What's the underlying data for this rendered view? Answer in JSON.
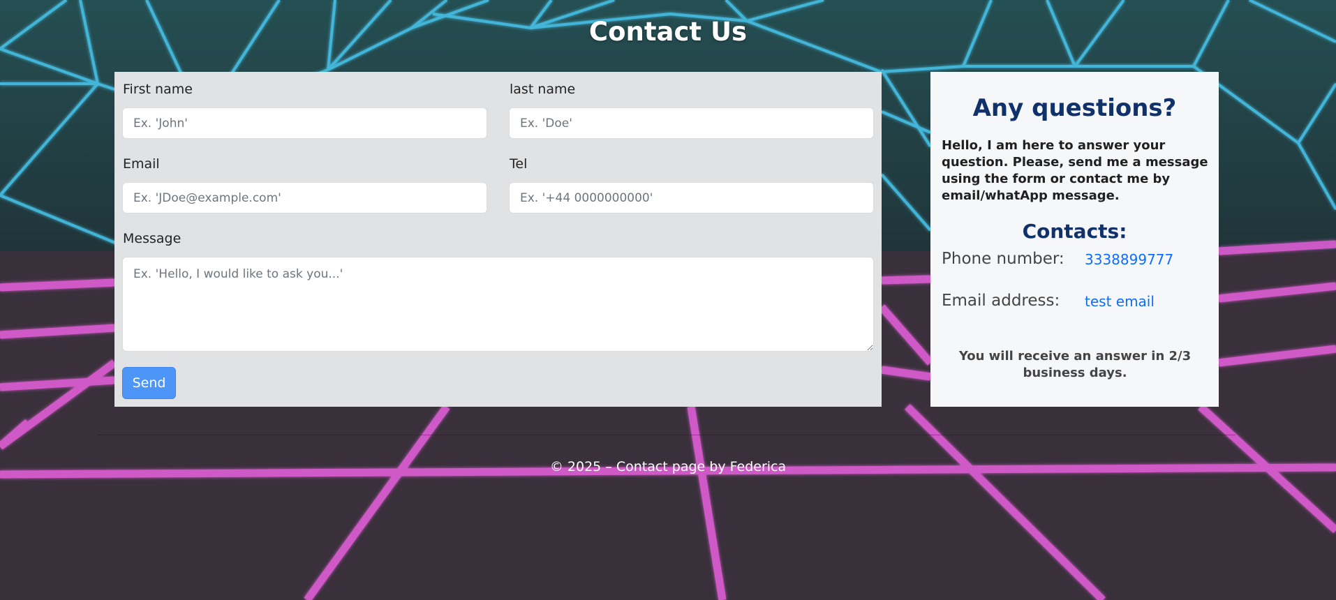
{
  "page": {
    "title": "Contact Us"
  },
  "form": {
    "first_name": {
      "label": "First name",
      "placeholder": "Ex. 'John'"
    },
    "last_name": {
      "label": "last name",
      "placeholder": "Ex. 'Doe'"
    },
    "email": {
      "label": "Email",
      "placeholder": "Ex. 'JDoe@example.com'"
    },
    "tel": {
      "label": "Tel",
      "placeholder": "Ex. '+44 0000000000'"
    },
    "message": {
      "label": "Message",
      "placeholder": "Ex. 'Hello, I would like to ask you...'"
    },
    "send_label": "Send"
  },
  "info": {
    "heading": "Any questions?",
    "text": "Hello, I am here to answer your question. Please, send me a message using the form or contact me by email/whatApp message.",
    "contacts_heading": "Contacts:",
    "phone_label": "Phone number:",
    "phone_value": "3338899777",
    "email_label": "Email address:",
    "email_value": "test email",
    "answer_note": "You will receive an answer in 2/3 business days."
  },
  "footer": {
    "text": "© 2025 – Contact page by Federica"
  },
  "colors": {
    "accent": "#0d6efd",
    "heading": "#11316a",
    "grid_cyan": "#4fd6ff",
    "grid_magenta": "#ff6cf4"
  }
}
